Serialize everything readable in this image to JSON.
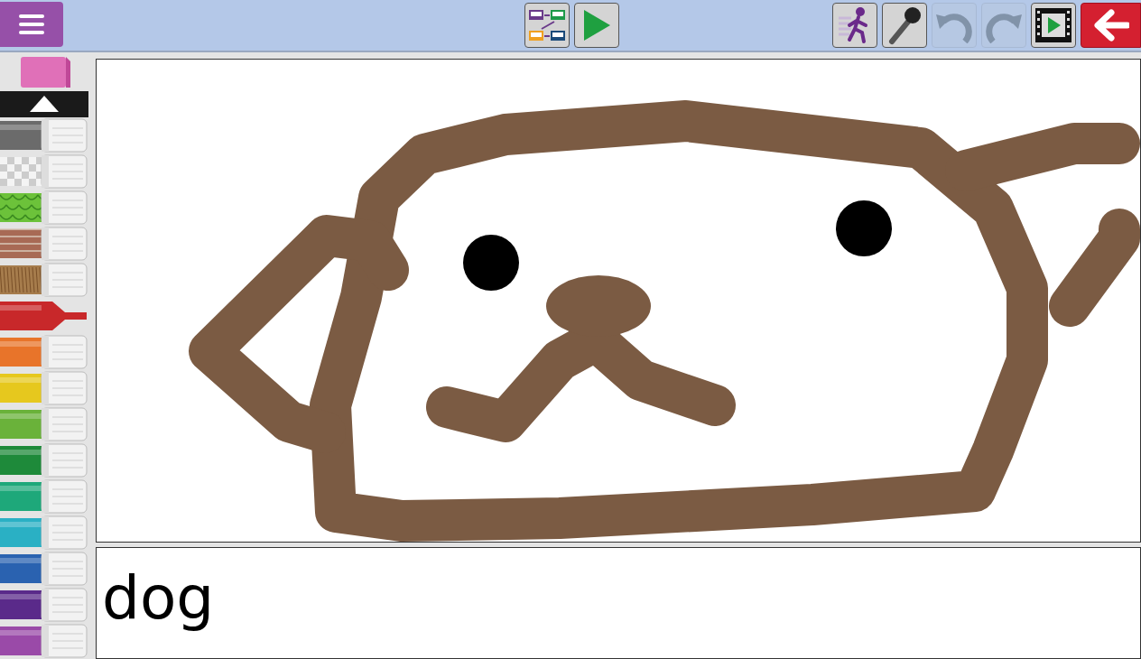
{
  "toolbar": {
    "center": [
      {
        "kind": "pages",
        "disabled": false
      },
      {
        "kind": "play",
        "disabled": false
      }
    ],
    "right": [
      {
        "kind": "animate",
        "disabled": false
      },
      {
        "kind": "mic",
        "disabled": false
      },
      {
        "kind": "undo",
        "disabled": true
      },
      {
        "kind": "redo",
        "disabled": true
      },
      {
        "kind": "movie",
        "disabled": false
      },
      {
        "kind": "back",
        "disabled": false
      }
    ]
  },
  "markers": [
    {
      "kind": "solid",
      "color": "#6b6b6b",
      "selected": false
    },
    {
      "kind": "checker",
      "color": "#cccccc",
      "selected": false
    },
    {
      "kind": "scales",
      "color": "#6cc23a",
      "selected": false
    },
    {
      "kind": "brick",
      "color": "#a86a55",
      "selected": false
    },
    {
      "kind": "fur",
      "color": "#a67c4c",
      "selected": false
    },
    {
      "kind": "solid",
      "color": "#c8282a",
      "selected": true
    },
    {
      "kind": "solid",
      "color": "#e8742a",
      "selected": false
    },
    {
      "kind": "solid",
      "color": "#e6c81e",
      "selected": false
    },
    {
      "kind": "solid",
      "color": "#6ab23a",
      "selected": false
    },
    {
      "kind": "solid",
      "color": "#1e8a3a",
      "selected": false
    },
    {
      "kind": "solid",
      "color": "#1ea87a",
      "selected": false
    },
    {
      "kind": "solid",
      "color": "#2ab0c4",
      "selected": false
    },
    {
      "kind": "solid",
      "color": "#2a62b0",
      "selected": false
    },
    {
      "kind": "solid",
      "color": "#5a2a8a",
      "selected": false
    },
    {
      "kind": "solid",
      "color": "#9a4aa8",
      "selected": false
    }
  ],
  "caption": {
    "value": "dog"
  }
}
